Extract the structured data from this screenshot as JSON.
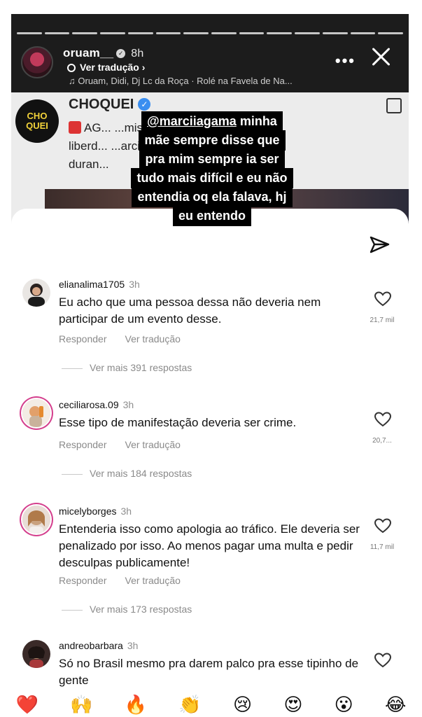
{
  "story": {
    "username": "oruam__",
    "time": "8h",
    "translate_label": "Ver tradução",
    "music": "Oruam, Didi, Dj Lc da Roça · Rolé na Favela de Na...",
    "post": {
      "account": "CHOQUEI",
      "logo_text": "CHO QUEI",
      "line1": "AG... ...mista pedindo a",
      "line2": "liberd... ...arcinho VP,",
      "line3": "duran..."
    },
    "caption": {
      "mention": "@marciiagama",
      "lines": [
        "minha",
        "mãe sempre disse que",
        "pra mim sempre ia ser",
        "tudo mais difícil e eu não",
        "entendia oq ela falava, hj",
        "eu entendo"
      ]
    }
  },
  "comments": [
    {
      "username": "elianalima1705",
      "time": "3h",
      "text": "Eu acho que uma pessoa dessa não deveria nem participar de um evento desse.",
      "reply_label": "Responder",
      "translate_label": "Ver tradução",
      "replies_label": "Ver mais 391 respostas",
      "likes": "21,7 mil"
    },
    {
      "username": "ceciliarosa.09",
      "time": "3h",
      "text": "Esse tipo de manifestação deveria ser crime.",
      "reply_label": "Responder",
      "translate_label": "Ver tradução",
      "replies_label": "Ver mais 184 respostas",
      "likes": "20,7..."
    },
    {
      "username": "micelyborges",
      "time": "3h",
      "text": "Entenderia isso como apologia ao tráfico.  Ele deveria ser penalizado por isso. Ao menos pagar uma multa e pedir desculpas publicamente!",
      "reply_label": "Responder",
      "translate_label": "Ver tradução",
      "replies_label": "Ver mais 173 respostas",
      "likes": "11,7 mil"
    },
    {
      "username": "andreobarbara",
      "time": "3h",
      "text": "Só no Brasil mesmo pra darem palco pra esse tipinho de gente",
      "likes": ""
    }
  ],
  "reactions": [
    "❤️",
    "🙌",
    "🔥",
    "👏",
    "😢",
    "😍",
    "😮",
    "😂"
  ],
  "colors": {
    "accent_ring": "#d43f8d",
    "verified_blue": "#3a8ef0",
    "story_bg": "#1c1c1c"
  }
}
